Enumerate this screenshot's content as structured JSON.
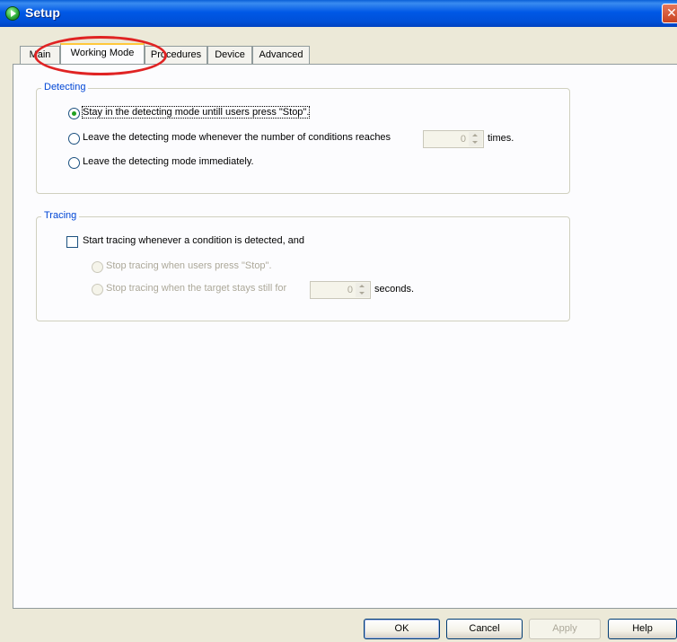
{
  "window": {
    "title": "Setup",
    "close_glyph": "✕"
  },
  "tabs": [
    {
      "label": "Main"
    },
    {
      "label": "Working Mode"
    },
    {
      "label": "Procedures"
    },
    {
      "label": "Device"
    },
    {
      "label": "Advanced"
    }
  ],
  "detecting": {
    "title": "Detecting",
    "option_stay": "Stay in the detecting mode untill users press \"Stop\".",
    "option_leave_count": "Leave the detecting mode whenever the number of conditions reaches",
    "count_value": "0",
    "count_suffix": "times.",
    "option_leave_now": "Leave the detecting mode immediately."
  },
  "tracing": {
    "title": "Tracing",
    "start_checkbox": "Start tracing whenever a condition is detected,  and",
    "option_stop_users": "Stop tracing when users press \"Stop\".",
    "option_stop_still": "Stop tracing when the target stays still for",
    "seconds_value": "0",
    "seconds_suffix": "seconds."
  },
  "buttons": {
    "ok": "OK",
    "cancel": "Cancel",
    "apply": "Apply",
    "help": "Help"
  },
  "colors": {
    "titlebar": "#0058E6",
    "group_title": "#0046D5",
    "active_tab_accent": "#FFC83C",
    "highlight": "#E02323"
  }
}
